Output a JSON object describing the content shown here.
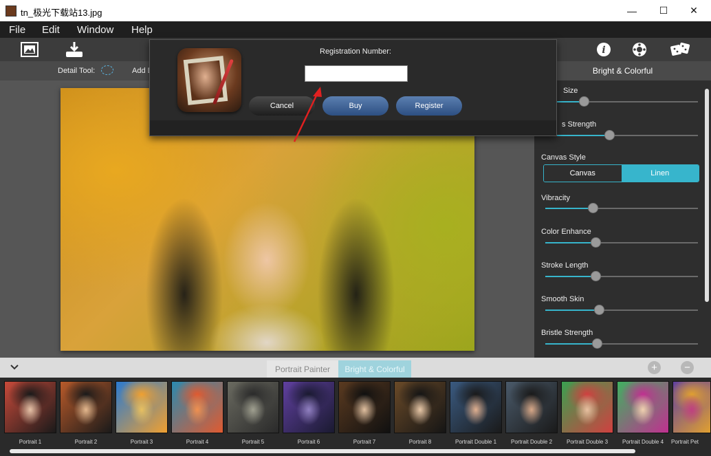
{
  "window": {
    "title": "tn_极光下载站13.jpg",
    "minimize": "—",
    "maximize": "☐",
    "close": "✕"
  },
  "menu": [
    "File",
    "Edit",
    "Window",
    "Help"
  ],
  "detail_bar": {
    "detail_tool_label": "Detail Tool:",
    "add_label": "Add D"
  },
  "right_panel": {
    "header": "Bright & Colorful",
    "sliders": [
      {
        "label": "Size",
        "value": 0.25
      },
      {
        "label": "s Strength",
        "value": 0.42
      },
      {
        "label": "Vibracity",
        "value": 0.31
      },
      {
        "label": "Color Enhance",
        "value": 0.33
      },
      {
        "label": "Stroke Length",
        "value": 0.33
      },
      {
        "label": "Smooth Skin",
        "value": 0.35
      },
      {
        "label": "Bristle Strength",
        "value": 0.34
      }
    ],
    "canvas_style": {
      "label": "Canvas Style",
      "options": [
        "Canvas",
        "Linen"
      ],
      "selected": "Linen"
    }
  },
  "dialog": {
    "registration_label": "Registration Number:",
    "registration_value": "",
    "buttons": {
      "cancel": "Cancel",
      "buy": "Buy",
      "register": "Register"
    }
  },
  "categories": {
    "tabs": [
      "Portrait Painter",
      "Bright & Colorful"
    ],
    "active": "Bright & Colorful"
  },
  "thumbnails": [
    {
      "label": "Portrait 1",
      "colors": [
        "#c84a3a",
        "#1a1a1a",
        "#e6c3a8"
      ]
    },
    {
      "label": "Portrait 2",
      "colors": [
        "#b85a2a",
        "#1a1a1a",
        "#e3b88e"
      ]
    },
    {
      "label": "Portrait 3",
      "colors": [
        "#2a7ad0",
        "#f0a030",
        "#e8c060"
      ]
    },
    {
      "label": "Portrait 4",
      "colors": [
        "#2a8ab0",
        "#e05a30",
        "#f09050"
      ]
    },
    {
      "label": "Portrait 5",
      "colors": [
        "#6a6a60",
        "#2a2a2a",
        "#a0a090"
      ]
    },
    {
      "label": "Portrait 6",
      "colors": [
        "#6040a0",
        "#1a1a30",
        "#9080c0"
      ]
    },
    {
      "label": "Portrait 7",
      "colors": [
        "#5a3a20",
        "#101010",
        "#e0c0a0"
      ]
    },
    {
      "label": "Portrait 8",
      "colors": [
        "#6a4a28",
        "#151515",
        "#e8c8a8"
      ]
    },
    {
      "label": "Portrait Double 1",
      "colors": [
        "#3a5a80",
        "#1a1a1a",
        "#e0b090"
      ]
    },
    {
      "label": "Portrait Double 2",
      "colors": [
        "#4a5a6a",
        "#1a1a1a",
        "#d8a888"
      ]
    },
    {
      "label": "Portrait Double 3",
      "colors": [
        "#3aa050",
        "#d04040",
        "#e8c0a0"
      ]
    },
    {
      "label": "Portrait Double 4",
      "colors": [
        "#40b060",
        "#c03090",
        "#f0d0b0"
      ]
    },
    {
      "label": "Portrait Pet",
      "colors": [
        "#6040a0",
        "#e0a030",
        "#c04080"
      ]
    }
  ]
}
